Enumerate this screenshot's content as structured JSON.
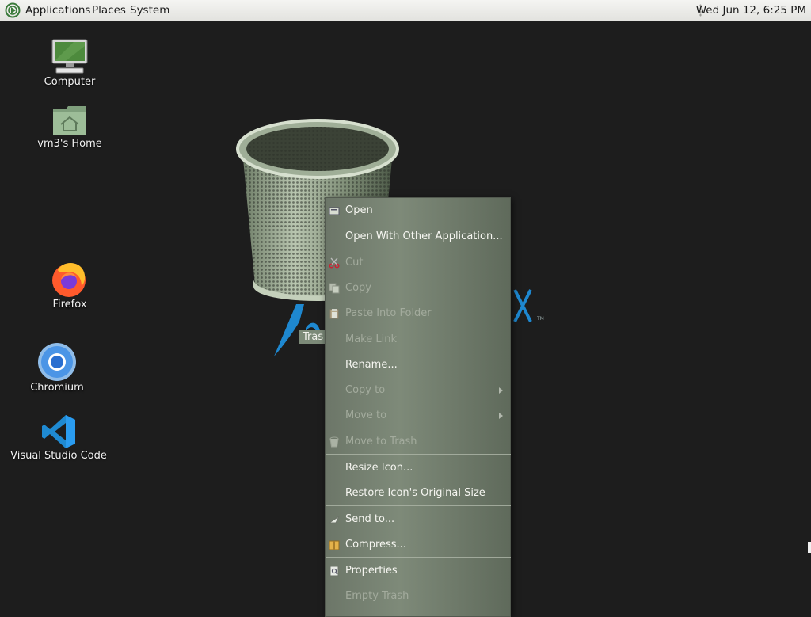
{
  "top_panel": {
    "menus": [
      "Applications",
      "Places",
      "System"
    ],
    "clock": "Wed Jun 12,  6:25 PM"
  },
  "desktop_icons": {
    "computer": "Computer",
    "home": "vm3's Home",
    "firefox": "Firefox",
    "chromium": "Chromium",
    "vscode": "Visual Studio Code",
    "trash": "Tras"
  },
  "context_menu": {
    "items": [
      {
        "label": "Open",
        "enabled": true,
        "icon": "open-icon"
      },
      {
        "label": "Open With Other Application...",
        "enabled": true
      },
      {
        "label": "Cut",
        "enabled": false,
        "icon": "scissors-icon"
      },
      {
        "label": "Copy",
        "enabled": false,
        "icon": "copy-icon"
      },
      {
        "label": "Paste Into Folder",
        "enabled": false,
        "icon": "paste-icon"
      },
      {
        "label": "Make Link",
        "enabled": false
      },
      {
        "label": "Rename...",
        "enabled": true
      },
      {
        "label": "Copy to",
        "enabled": false,
        "submenu": true
      },
      {
        "label": "Move to",
        "enabled": false,
        "submenu": true
      },
      {
        "label": "Move to Trash",
        "enabled": false,
        "icon": "trash-icon"
      },
      {
        "label": "Resize Icon...",
        "enabled": true
      },
      {
        "label": "Restore Icon's Original Size",
        "enabled": true
      },
      {
        "label": "Send to...",
        "enabled": true,
        "icon": "send-icon"
      },
      {
        "label": "Compress...",
        "enabled": true,
        "icon": "archive-icon"
      },
      {
        "label": "Properties",
        "enabled": true,
        "icon": "properties-icon"
      },
      {
        "label": "Empty Trash",
        "enabled": false
      }
    ]
  },
  "colors": {
    "desktop_bg": "#1d1d1d",
    "menu_bg": "#7e8a79",
    "disabled_text": "#a3ab9d",
    "brand_blue": "#1e88d0"
  }
}
